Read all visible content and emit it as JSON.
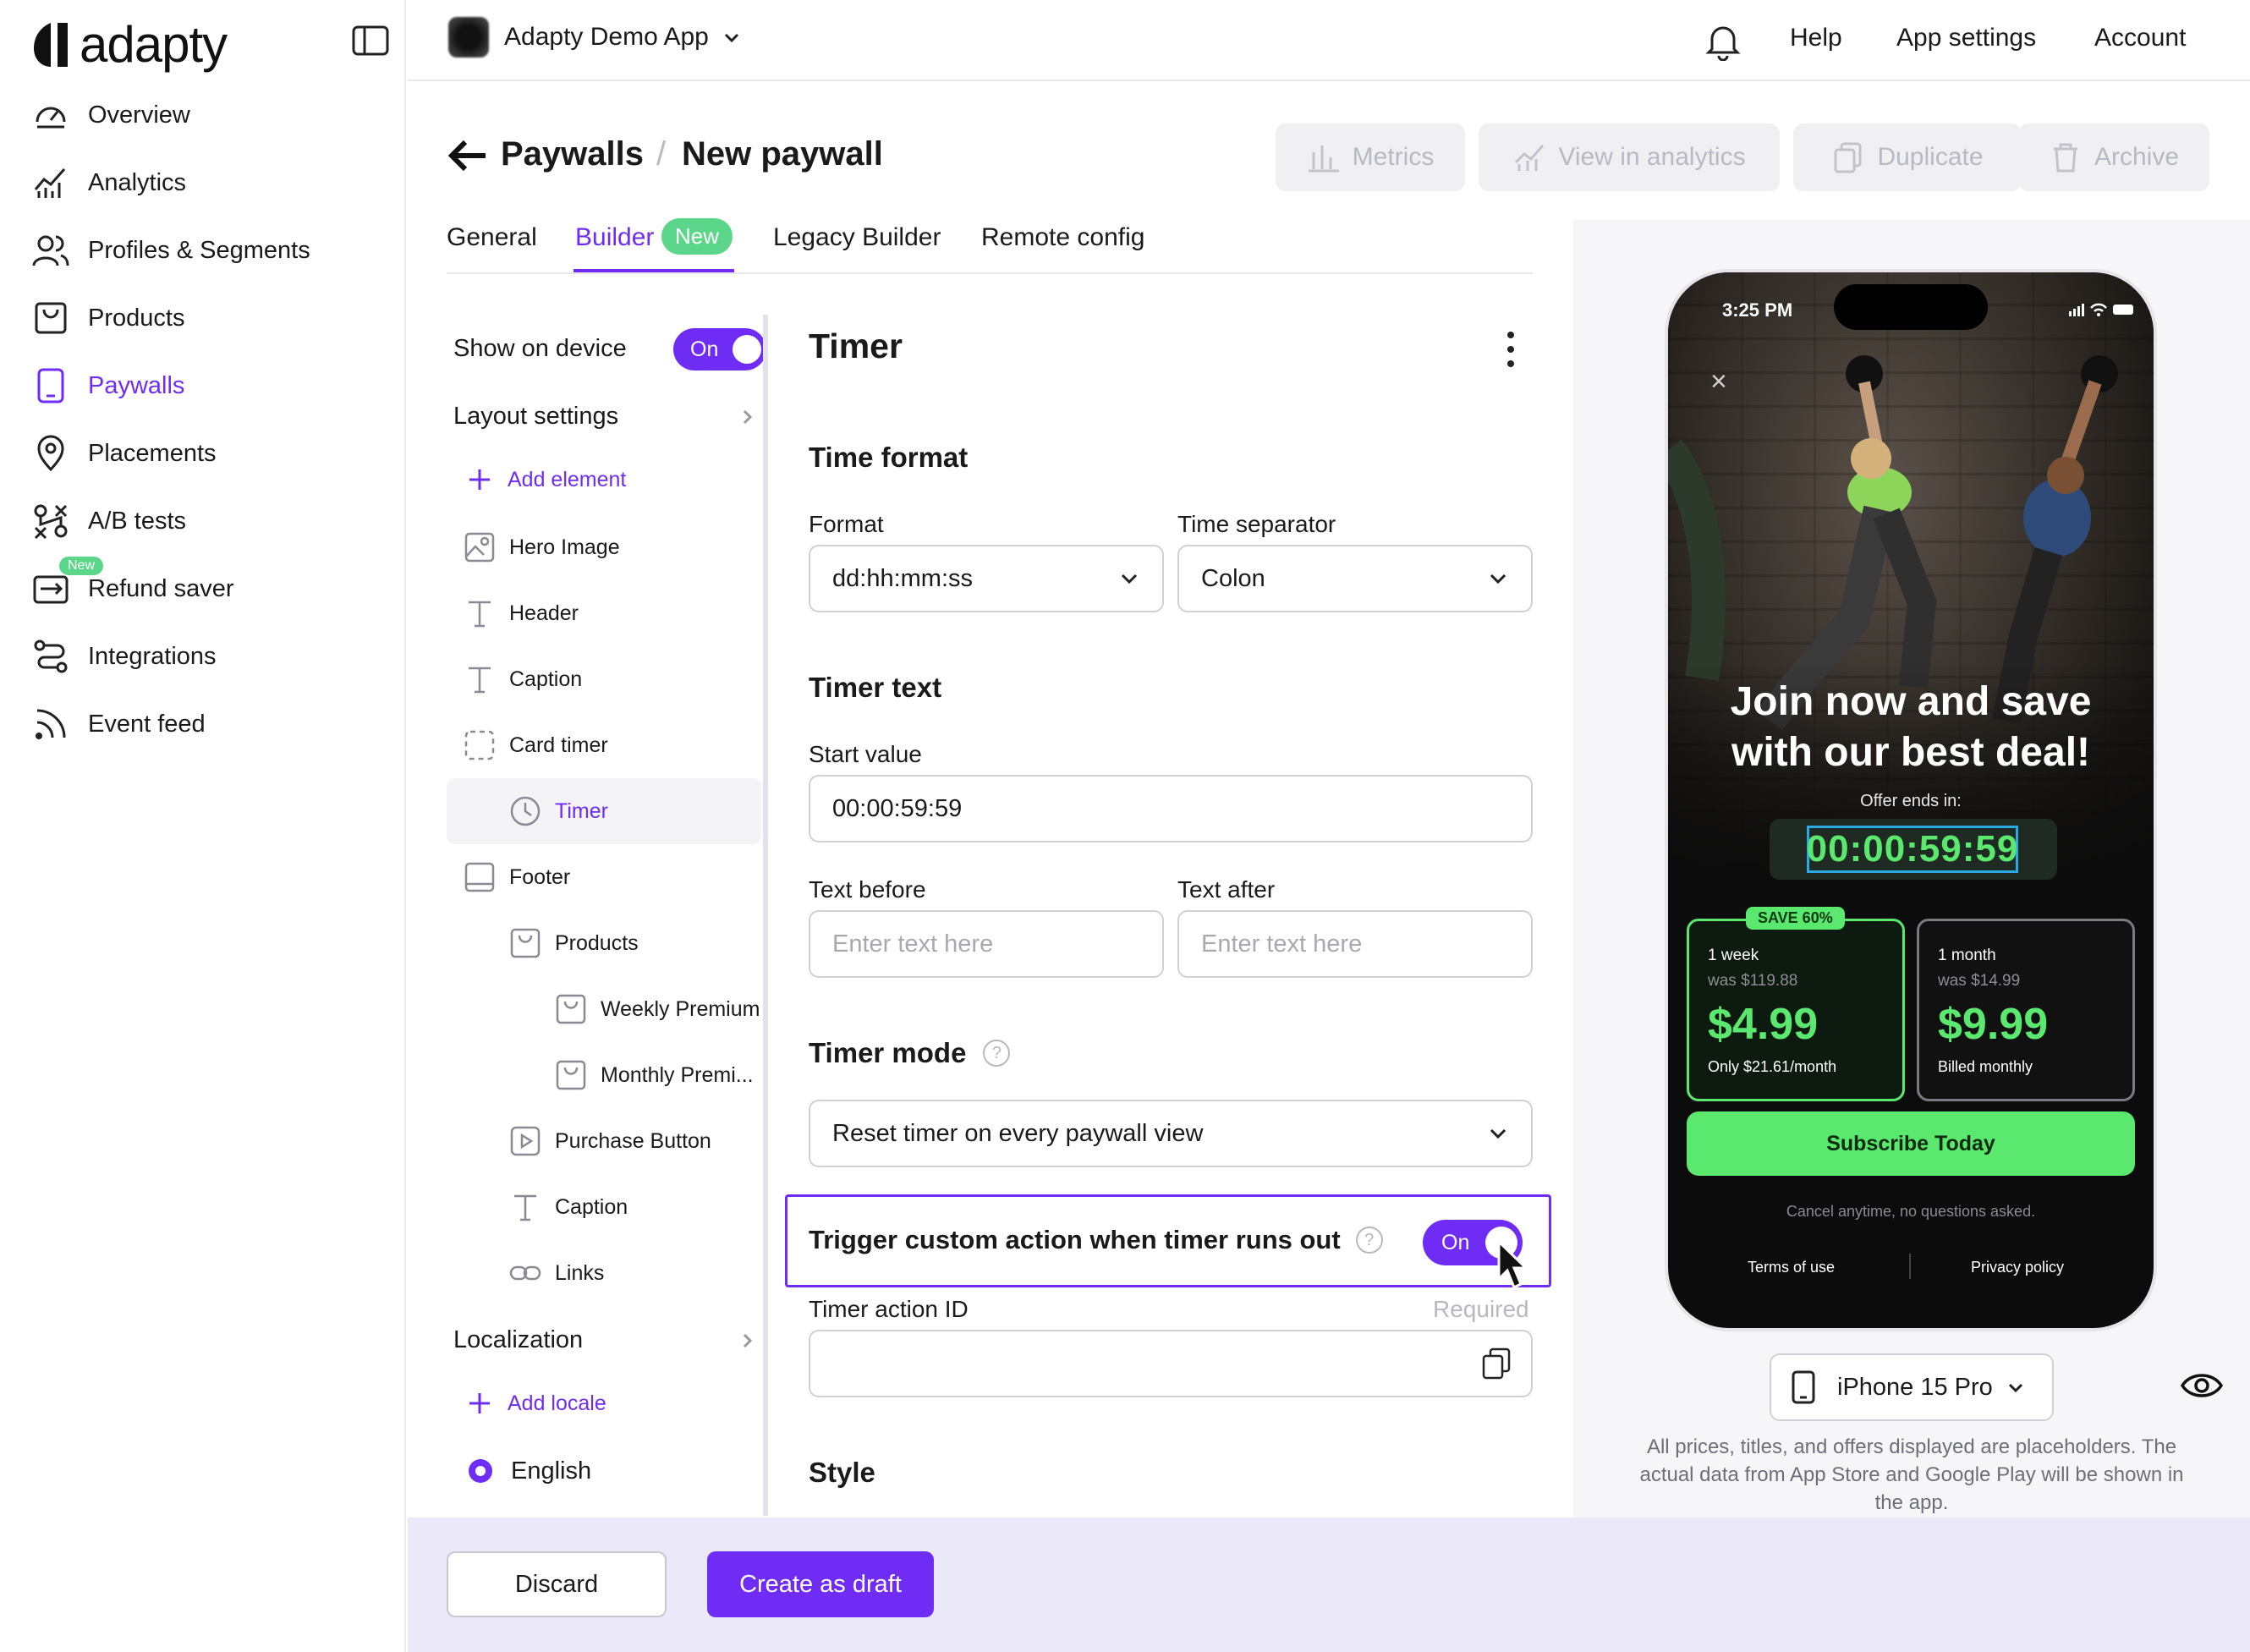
{
  "brand": {
    "name": "adapty",
    "accent": "#6f2cf5",
    "success": "#5cd68a"
  },
  "sidebar": {
    "collapse_icon": "sidebar-toggle-icon",
    "new_label": "New",
    "items": [
      {
        "label": "Overview",
        "icon": "gauge-icon"
      },
      {
        "label": "Analytics",
        "icon": "analytics-icon"
      },
      {
        "label": "Profiles & Segments",
        "icon": "users-icon"
      },
      {
        "label": "Products",
        "icon": "box-icon"
      },
      {
        "label": "Paywalls",
        "icon": "phone-icon",
        "active": true
      },
      {
        "label": "Placements",
        "icon": "pin-icon"
      },
      {
        "label": "A/B tests",
        "icon": "ab-test-icon"
      },
      {
        "label": "Refund saver",
        "icon": "refund-icon"
      },
      {
        "label": "Integrations",
        "icon": "integrations-icon"
      },
      {
        "label": "Event feed",
        "icon": "rss-icon"
      }
    ]
  },
  "topbar": {
    "app_name": "Adapty Demo App",
    "help": "Help",
    "app_settings": "App settings",
    "account": "Account"
  },
  "header": {
    "breadcrumb_root": "Paywalls",
    "breadcrumb_sep": "/",
    "title": "New paywall",
    "metrics": "Metrics",
    "view_in_analytics": "View in analytics",
    "duplicate": "Duplicate",
    "archive": "Archive"
  },
  "tabs": {
    "general": "General",
    "builder": "Builder",
    "builder_badge": "New",
    "legacy": "Legacy Builder",
    "remote": "Remote config"
  },
  "tree": {
    "show_on_device": "Show on device",
    "toggle_on": "On",
    "layout_settings": "Layout settings",
    "add_element": "Add element",
    "hero_image": "Hero Image",
    "header": "Header",
    "caption": "Caption",
    "card_timer": "Card timer",
    "timer": "Timer",
    "footer": "Footer",
    "products": "Products",
    "weekly": "Weekly Premium",
    "monthly": "Monthly Premi...",
    "purchase_button": "Purchase Button",
    "caption2": "Caption",
    "links": "Links",
    "localization": "Localization",
    "add_locale": "Add locale",
    "english": "English"
  },
  "settings": {
    "title": "Timer",
    "time_format_title": "Time format",
    "format_label": "Format",
    "format_value": "dd:hh:mm:ss",
    "separator_label": "Time separator",
    "separator_value": "Colon",
    "timer_text_title": "Timer text",
    "start_value_label": "Start value",
    "start_value": "00:00:59:59",
    "text_before_label": "Text before",
    "text_before_placeholder": "Enter text here",
    "text_after_label": "Text after",
    "text_after_placeholder": "Enter text here",
    "timer_mode_title": "Timer mode",
    "timer_mode_value": "Reset timer on every paywall view",
    "trigger_label": "Trigger custom action when timer runs out",
    "trigger_toggle": "On",
    "action_id_label": "Timer action ID",
    "action_id_required": "Required",
    "style_title": "Style",
    "help_glyph": "?"
  },
  "preview": {
    "status_time": "3:25 PM",
    "close_glyph": "×",
    "headline_line1": "Join now and save",
    "headline_line2": "with our best deal!",
    "offer_text": "Offer ends in:",
    "timer": "00:00:59:59",
    "save_badge": "SAVE 60%",
    "card1": {
      "period": "1 week",
      "was": "was $119.88",
      "price": "$4.99",
      "sub": "Only $21.61/month"
    },
    "card2": {
      "period": "1 month",
      "was": "was $14.99",
      "price": "$9.99",
      "sub": "Billed monthly"
    },
    "cta": "Subscribe Today",
    "cancel": "Cancel anytime, no questions asked.",
    "terms": "Terms of use",
    "privacy": "Privacy policy",
    "device": "iPhone 15 Pro",
    "note": "All prices, titles, and offers displayed are placeholders. The actual data from App Store and Google Play will be shown in the app."
  },
  "footer": {
    "discard": "Discard",
    "create_draft": "Create as draft"
  }
}
